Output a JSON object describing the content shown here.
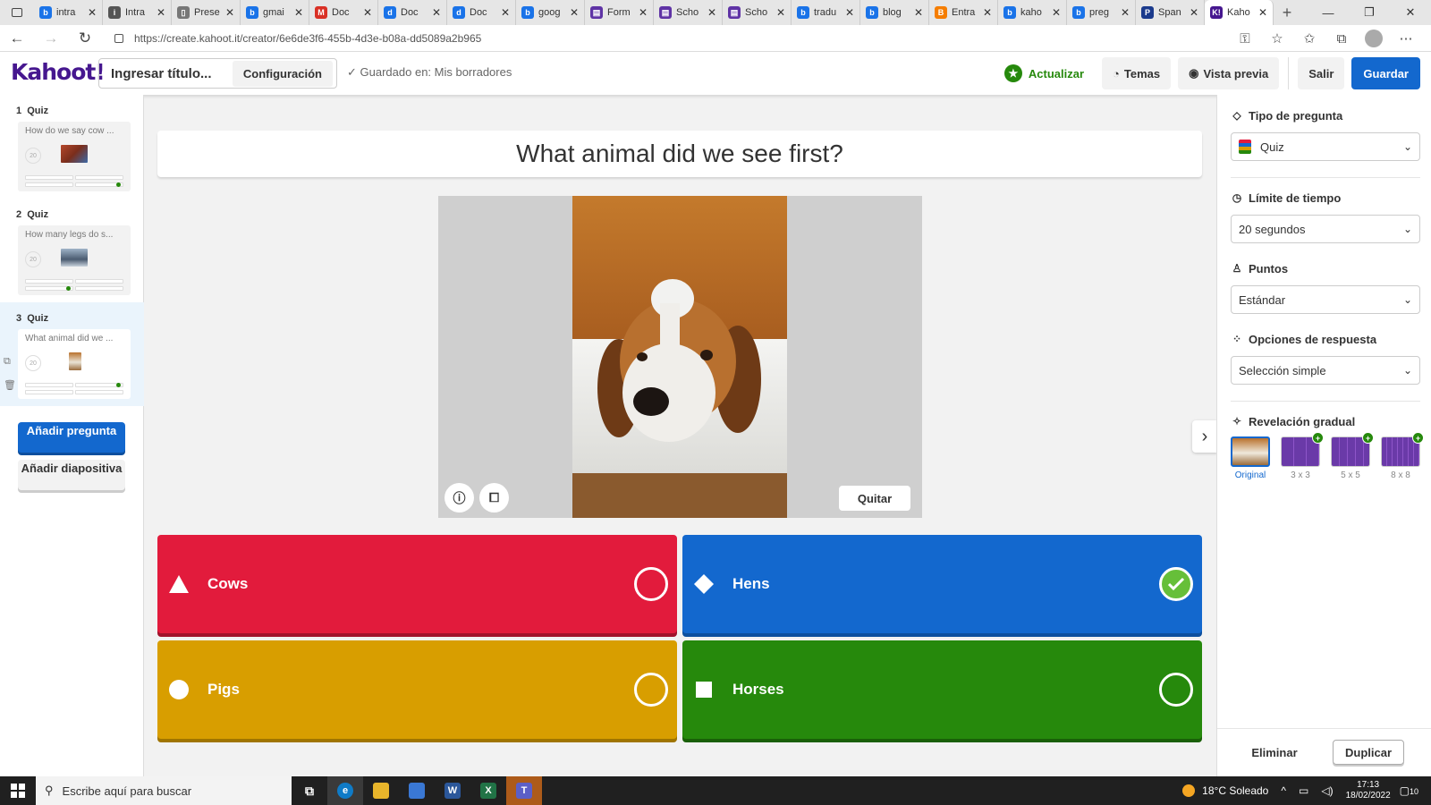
{
  "browser": {
    "tabs": [
      {
        "label": "intra",
        "fav": "b",
        "color": "#1a73e8"
      },
      {
        "label": "Intra",
        "fav": "i",
        "color": "#555555"
      },
      {
        "label": "Prese",
        "fav": "▯",
        "color": "#777777"
      },
      {
        "label": "gmai",
        "fav": "b",
        "color": "#1a73e8"
      },
      {
        "label": "Doc",
        "fav": "M",
        "color": "#d93025"
      },
      {
        "label": "Doc",
        "fav": "d",
        "color": "#1a73e8"
      },
      {
        "label": "Doc",
        "fav": "d",
        "color": "#1a73e8"
      },
      {
        "label": "goog",
        "fav": "b",
        "color": "#1a73e8"
      },
      {
        "label": "Form",
        "fav": "▤",
        "color": "#5f33a5"
      },
      {
        "label": "Scho",
        "fav": "▤",
        "color": "#5f33a5"
      },
      {
        "label": "Scho",
        "fav": "▤",
        "color": "#5f33a5"
      },
      {
        "label": "tradu",
        "fav": "b",
        "color": "#1a73e8"
      },
      {
        "label": "blog",
        "fav": "b",
        "color": "#1a73e8"
      },
      {
        "label": "Entra",
        "fav": "B",
        "color": "#f57d00"
      },
      {
        "label": "kaho",
        "fav": "b",
        "color": "#1a73e8"
      },
      {
        "label": "preg",
        "fav": "b",
        "color": "#1a73e8"
      },
      {
        "label": "Span",
        "fav": "P",
        "color": "#1b3a8c"
      },
      {
        "label": "Kaho",
        "fav": "K!",
        "color": "#46178f"
      }
    ],
    "url": "https://create.kahoot.it/creator/6e6de3f6-455b-4d3e-b08a-dd5089a2b965"
  },
  "header": {
    "logo": "Kahoot!",
    "title_placeholder": "Ingresar título...",
    "settings_label": "Configuración",
    "saved_text": "Guardado en: Mis borradores",
    "upgrade_label": "Actualizar",
    "themes_label": "Temas",
    "preview_label": "Vista previa",
    "exit_label": "Salir",
    "save_label": "Guardar"
  },
  "slides": [
    {
      "num": "1",
      "type": "Quiz",
      "text": "How do we say cow ...",
      "time": "20",
      "correct": 1
    },
    {
      "num": "2",
      "type": "Quiz",
      "text": "How many legs do s...",
      "time": "20",
      "correct": 0
    },
    {
      "num": "3",
      "type": "Quiz",
      "text": "What animal did we ...",
      "time": "20",
      "correct": 1
    }
  ],
  "sidebar": {
    "add_question": "Añadir pregunta",
    "add_slide": "Añadir diapositiva"
  },
  "question": {
    "title": "What animal did we see first?",
    "remove_media": "Quitar",
    "answers": [
      {
        "label": "Cows",
        "correct": false
      },
      {
        "label": "Hens",
        "correct": true
      },
      {
        "label": "Pigs",
        "correct": false
      },
      {
        "label": "Horses",
        "correct": false
      }
    ]
  },
  "settings": {
    "question_type_label": "Tipo de pregunta",
    "question_type_value": "Quiz",
    "time_limit_label": "Límite de tiempo",
    "time_limit_value": "20 segundos",
    "points_label": "Puntos",
    "points_value": "Estándar",
    "answer_options_label": "Opciones de respuesta",
    "answer_options_value": "Selección simple",
    "reveal_label": "Revelación gradual",
    "reveal_options": [
      "Original",
      "3 x 3",
      "5 x 5",
      "8 x 8"
    ],
    "delete_label": "Eliminar",
    "duplicate_label": "Duplicar"
  },
  "taskbar": {
    "search_placeholder": "Escribe aquí para buscar",
    "weather": "18°C  Soleado",
    "time": "17:13",
    "date": "18/02/2022",
    "notifications": "10"
  }
}
